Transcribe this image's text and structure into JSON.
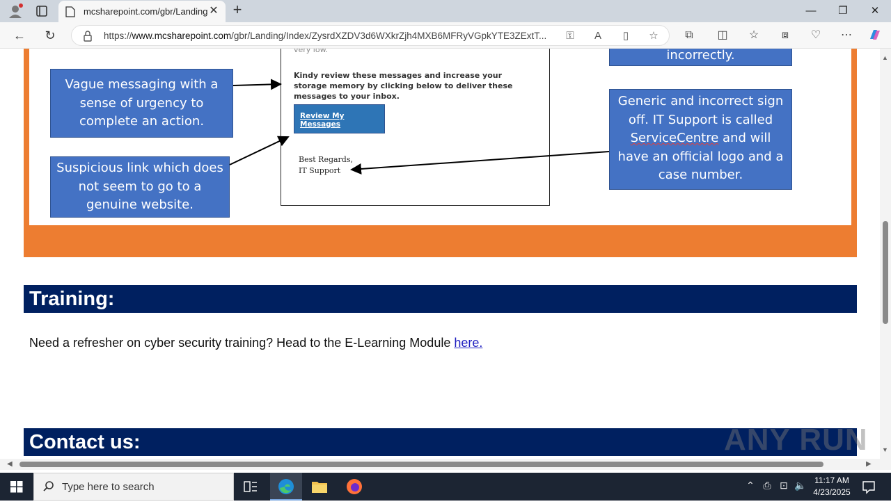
{
  "browser": {
    "tab_title": "mcsharepoint.com/gbr/Landing",
    "url_prefix": "https://",
    "url_domain": "www.mcsharepoint.com",
    "url_path": "/gbr/Landing/Index/ZysrdXZDV3d6WXkrZjh4MXB6MFRyVGpkYTE3ZExtT..."
  },
  "page": {
    "email": {
      "faded_text": "very low.",
      "body": "Kindy review these messages and increase your storage memory by clicking below to deliver these messages to your inbox.",
      "button_label": "Review My Messages",
      "signoff_line1": "Best Regards,",
      "signoff_line2": "IT Support"
    },
    "callouts": {
      "top_right": "incorrectly.",
      "vague": "Vague messaging with a sense of urgency to complete an action.",
      "suspicious": "Suspicious link which does not seem to go to a genuine website.",
      "generic_before": "Generic and incorrect sign off. IT Support is called ",
      "generic_underlined": "ServiceCentre",
      "generic_after": " and will have an official logo and a case number."
    },
    "training": {
      "heading": "Training:",
      "text": "Need a refresher on cyber security training? Head to the E-Learning Module ",
      "link": "here."
    },
    "contact": {
      "heading": "Contact us:"
    },
    "watermark": "ANY RUN"
  },
  "taskbar": {
    "search_placeholder": "Type here to search",
    "time": "11:17 AM",
    "date": "4/23/2025"
  },
  "colors": {
    "orange": "#ed7d31",
    "callout_blue": "#4472c4",
    "header_navy": "#002060"
  }
}
